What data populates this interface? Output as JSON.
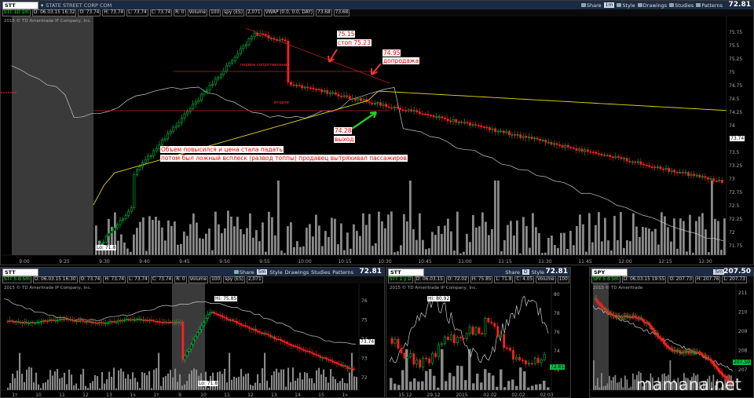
{
  "main": {
    "symbol": "STT",
    "company": "STATE STREET CORP COM",
    "price": "72.81",
    "toolbar": {
      "share": "Share",
      "timeframe": "1m",
      "style": "Style",
      "drawings": "Drawings",
      "studies": "Studies",
      "patterns": "Patterns"
    },
    "quote": {
      "agg": "STT 1D 1m",
      "date": "D: 06.03.15 16:32",
      "open": "O: 73.74",
      "high": "H: 73.74",
      "low": "L: 73.74",
      "close": "C: 73.74",
      "range": "R: 0",
      "volume_label": "Volume",
      "volume": "100",
      "spy": "spy (ES)",
      "spy_val": "2,071",
      "vwap": "VWAP (0.0, 0.0, DAY)",
      "vwap_val1": "73.68",
      "vwap_val2": "73.68"
    },
    "copyright": "2015 © TD Ameritrade IP Company, Inc.",
    "yaxis": [
      "75.75",
      "75.5",
      "75.25",
      "75",
      "74.75",
      "74.5",
      "74.25",
      "74",
      "73.75",
      "73.5",
      "73.25",
      "73",
      "72.75",
      "72.5",
      "72.25",
      "72",
      "71.75"
    ],
    "last_tag": "73.74",
    "low_tag": "Lo: 71.8",
    "xaxis": [
      "9:00",
      "9:25",
      "9:30",
      "9:40",
      "9:45",
      "9:50",
      "9:55",
      "10:00",
      "10:15",
      "10:30",
      "10:45",
      "11:00",
      "11:15",
      "11:30",
      "11:45",
      "12:00",
      "12:15",
      "12:30"
    ],
    "annotations": {
      "a1_price": "75.15",
      "a1_text": "стоп 75.23",
      "a2_price": "74.95",
      "a2_text": "допродажа",
      "a3_price": "74.28",
      "a3_text": "выход",
      "comment1": "Объем повысился и цена стала падать",
      "comment2": "потом был ложный всплеск (развод топпы) продавец вытряхивал пассажиров",
      "line1": "первое сопротивление",
      "line2": "второе"
    }
  },
  "bl": {
    "symbol": "STT",
    "timeframe": "5m",
    "price": "72.81",
    "quote": {
      "agg": "STT 5 d 5m",
      "date": "D: 06.03.15 16:30",
      "open": "O: 73.74",
      "high": "H: 73.74",
      "low": "L: 73.74",
      "close": "C: 73.74",
      "range": "R: 0",
      "volume_label": "Volume",
      "volume": "100",
      "spy": "spy (ES)",
      "spy_val": "2,071"
    },
    "copyright": "2015 © TD Ameritrade IP Company, Inc.",
    "hi_tag": "Hi: 75.85",
    "lo_tag": "Lo: 71.8",
    "last_tag": "73.74",
    "yaxis": [
      "76",
      "75",
      "74",
      "73",
      "72"
    ],
    "xaxis": [
      "1т",
      "10",
      "11",
      "12",
      "13",
      "1ч",
      "1т",
      "9",
      "10",
      "11",
      "12",
      "13",
      "14",
      "15",
      "1ч"
    ]
  },
  "bm": {
    "symbol": "STT",
    "timeframe": "D",
    "price": "72.81",
    "quote": {
      "agg": "STT 1 y D",
      "date": "D: 06.03.15",
      "open": "O: 72.02",
      "high": "H: 75.85",
      "low": "L: 71.8",
      "close": "C: 4.05",
      "volume_label": "Volume",
      "volume": "100"
    },
    "copyright": "2015 © TD Ameritrade IP Company, Inc.",
    "hi_tag": "Hi: 80.92",
    "last_tag": "72.81",
    "yaxis": [
      "80",
      "78",
      "76",
      "74",
      "72"
    ],
    "xaxis": [
      "15.12",
      "29.12",
      "2015",
      "02.02",
      "02.02",
      "02.03"
    ]
  },
  "br": {
    "symbol": "SPY",
    "timeframe": "5m",
    "price": "207.50",
    "quote": {
      "agg": "SPY 5 d 5m",
      "date": "D: 06.03.15 19:55",
      "open": "O: 207.73",
      "high": "H: 207.76",
      "low": "L: 207.73"
    },
    "copyright": "2015 © TD Ameritrade",
    "yaxis": [
      "211",
      "210",
      "209",
      "208",
      "207"
    ],
    "last_tag": "207.50"
  },
  "watermark": "mamana.net",
  "colors": {
    "up": "#00c040",
    "down": "#ff2020",
    "vwap": "#e0d020",
    "volume": "#8a8a8a",
    "premarket": "#3a3a3a",
    "titlebar": "#1c2b44"
  }
}
